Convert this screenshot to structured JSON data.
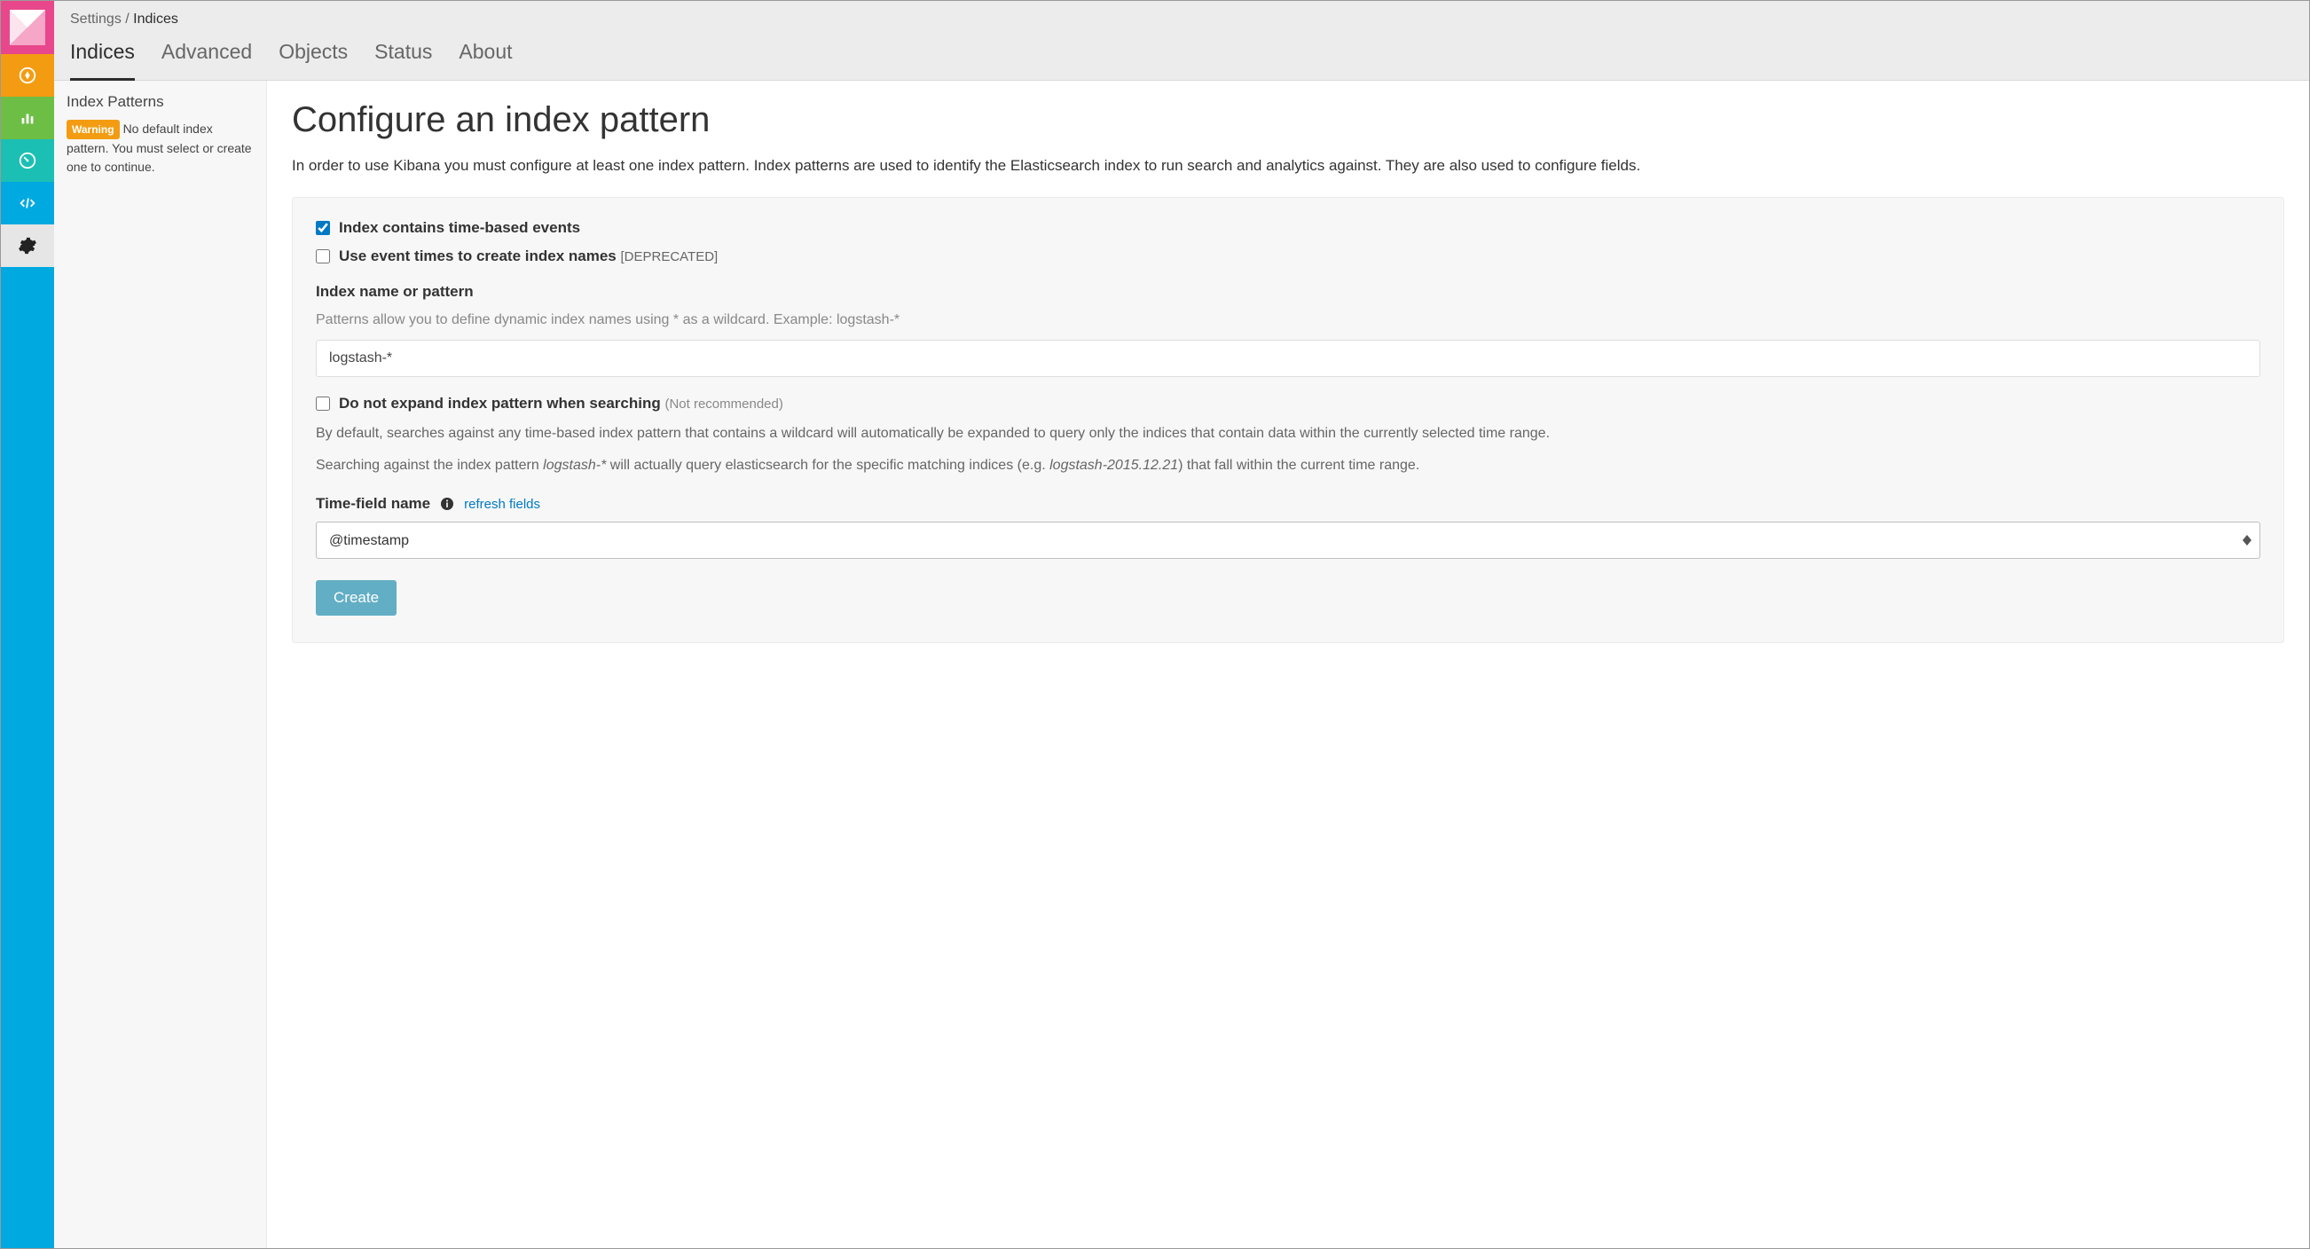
{
  "breadcrumb": {
    "root": "Settings",
    "sep": " / ",
    "current": "Indices"
  },
  "tabs": {
    "indices": "Indices",
    "advanced": "Advanced",
    "objects": "Objects",
    "status": "Status",
    "about": "About"
  },
  "sub_sidebar": {
    "title": "Index Patterns",
    "warning_badge": "Warning",
    "warning_text": "No default index pattern. You must select or create one to continue."
  },
  "page": {
    "title": "Configure an index pattern",
    "intro": "In order to use Kibana you must configure at least one index pattern. Index patterns are used to identify the Elasticsearch index to run search and analytics against. They are also used to configure fields."
  },
  "form": {
    "time_based_label": "Index contains time-based events",
    "time_based_checked": true,
    "event_times_label": "Use event times to create index names",
    "event_times_deprecated": "[DEPRECATED]",
    "event_times_checked": false,
    "index_name_label": "Index name or pattern",
    "index_name_hint": "Patterns allow you to define dynamic index names using * as a wildcard. Example: logstash-*",
    "index_name_value": "logstash-*",
    "no_expand_label": "Do not expand index pattern when searching",
    "no_expand_note": "(Not recommended)",
    "no_expand_checked": false,
    "no_expand_desc1": "By default, searches against any time-based index pattern that contains a wildcard will automatically be expanded to query only the indices that contain data within the currently selected time range.",
    "no_expand_desc2_a": "Searching against the index pattern ",
    "no_expand_desc2_em1": "logstash-*",
    "no_expand_desc2_b": " will actually query elasticsearch for the specific matching indices (e.g. ",
    "no_expand_desc2_em2": "logstash-2015.12.21",
    "no_expand_desc2_c": ") that fall within the current time range.",
    "time_field_label": "Time-field name",
    "refresh_link": "refresh fields",
    "time_field_value": "@timestamp",
    "create_button": "Create"
  }
}
